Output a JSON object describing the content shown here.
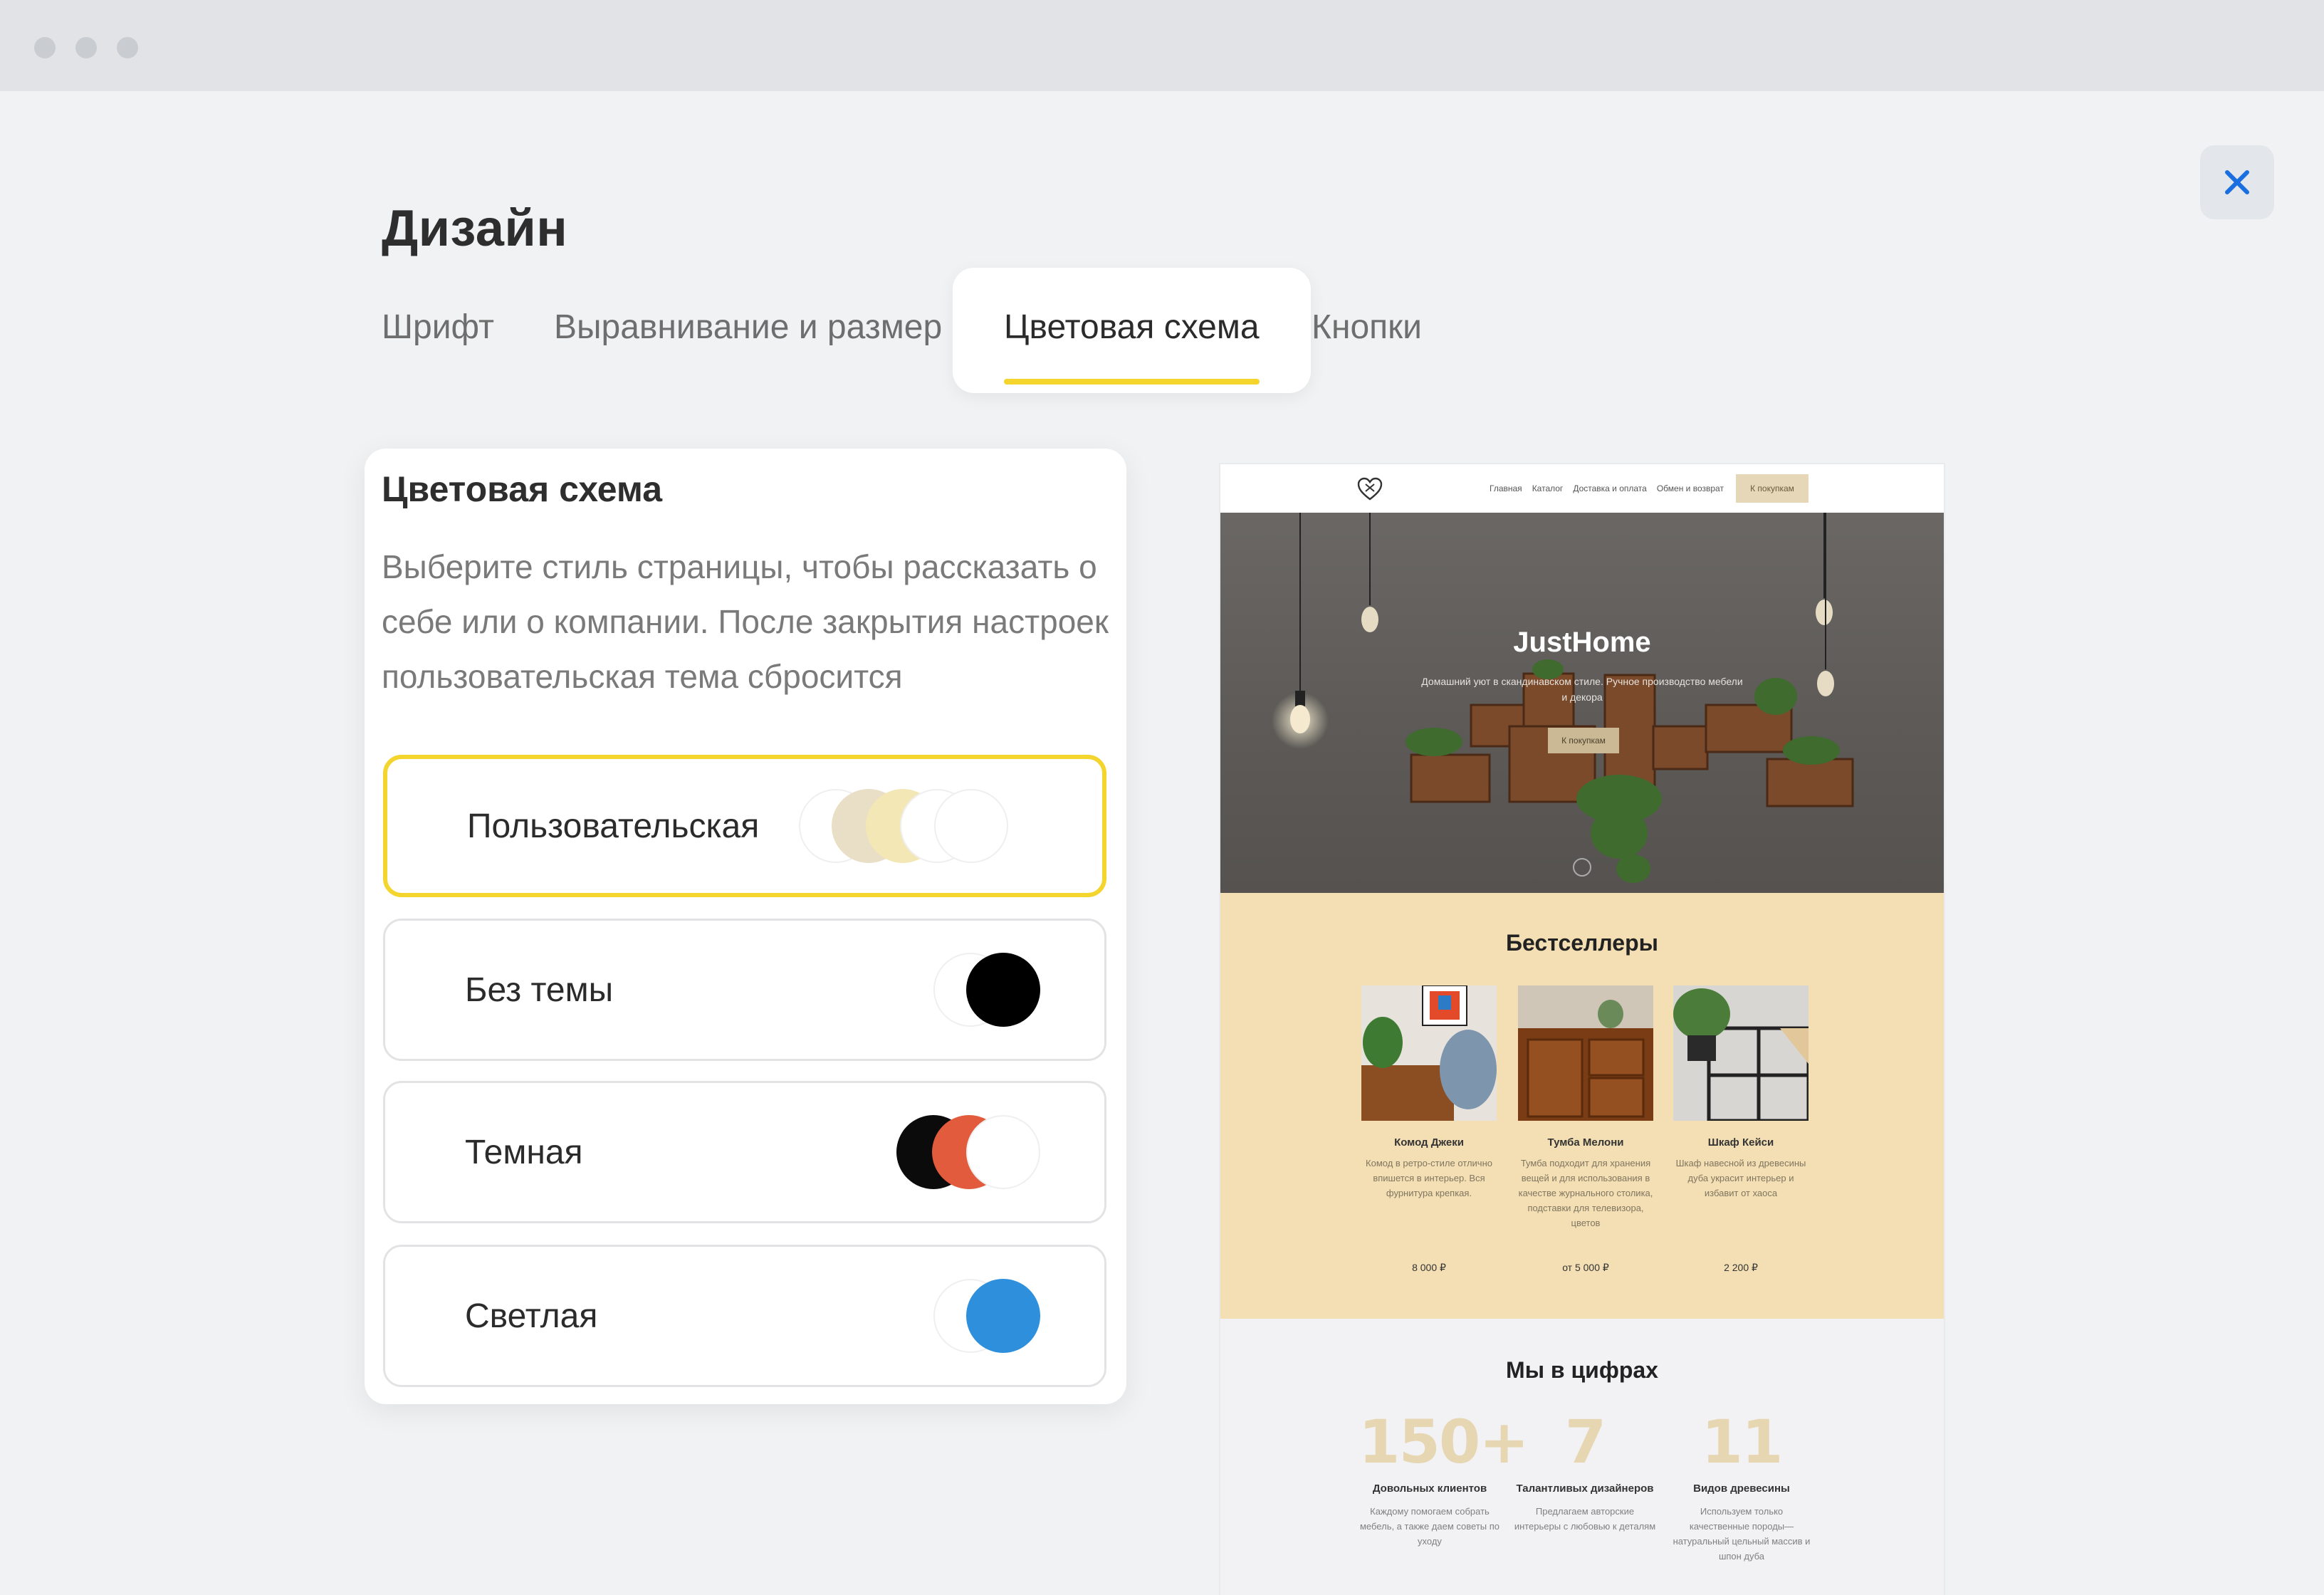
{
  "window": {
    "controls": [
      "dot",
      "dot",
      "dot"
    ]
  },
  "page": {
    "title": "Дизайн"
  },
  "tabs": [
    {
      "label": "Шрифт",
      "active": false
    },
    {
      "label": "Выравнивание и размер",
      "active": false
    },
    {
      "label": "Цветовая схема",
      "active": true
    },
    {
      "label": "Кнопки",
      "active": false
    }
  ],
  "close": {
    "icon": "close-icon",
    "color": "#1a6fe0"
  },
  "panel": {
    "title": "Цветовая схема",
    "description": "Выберите стиль страницы, чтобы рассказать о себе или о компании. После закрытия настроек пользовательская тема сбросится",
    "options": [
      {
        "label": "Пользовательская",
        "selected": true,
        "swatches": [
          "#e9dec6",
          "#f4e7b6",
          "#ffffff",
          "#ffffff"
        ]
      },
      {
        "label": "Без темы",
        "selected": false,
        "swatches": [
          "#ffffff",
          "#000000"
        ]
      },
      {
        "label": "Темная",
        "selected": false,
        "swatches": [
          "#0b0b0b",
          "#e15b3c",
          "#ffffff"
        ]
      },
      {
        "label": "Светлая",
        "selected": false,
        "swatches": [
          "#ffffff",
          "#2e90dd"
        ]
      }
    ],
    "accent": "#f3d52e"
  },
  "preview": {
    "nav": {
      "logo": "heart-logo-icon",
      "links": [
        "Главная",
        "Каталог",
        "Доставка и оплата",
        "Обмен и возврат"
      ],
      "button": "К покупкам"
    },
    "hero": {
      "brand": "JustHome",
      "subtitle": "Домашний уют в скандинавском стиле. Ручное производство мебели и декора",
      "button": "К покупкам"
    },
    "bestsellers": {
      "title": "Бестселлеры",
      "products": [
        {
          "name": "Комод Джеки",
          "desc": "Комод в ретро-стиле отлично впишется в интерьер. Вся фурнитура крепкая.",
          "price": "8 000 ₽"
        },
        {
          "name": "Тумба Мелони",
          "desc": "Тумба подходит для хранения вещей и для использования в качестве журнального столика, подставки для телевизора, цветов",
          "price": "от 5 000 ₽"
        },
        {
          "name": "Шкаф Кейси",
          "desc": "Шкаф навесной из древесины дуба украсит интерьер и избавит от хаоса",
          "price": "2 200 ₽"
        }
      ]
    },
    "stats": {
      "title": "Мы в цифрах",
      "items": [
        {
          "number": "150+",
          "label": "Довольных клиентов",
          "desc": "Каждому помогаем собрать мебель, а также даем советы по уходу"
        },
        {
          "number": "7",
          "label": "Талантливых дизайнеров",
          "desc": "Предлагаем авторские интерьеры с любовью к деталям"
        },
        {
          "number": "11",
          "label": "Видов древесины",
          "desc": "Используем только качественные породы— натуральный цельный массив и шпон дуба"
        }
      ]
    }
  }
}
